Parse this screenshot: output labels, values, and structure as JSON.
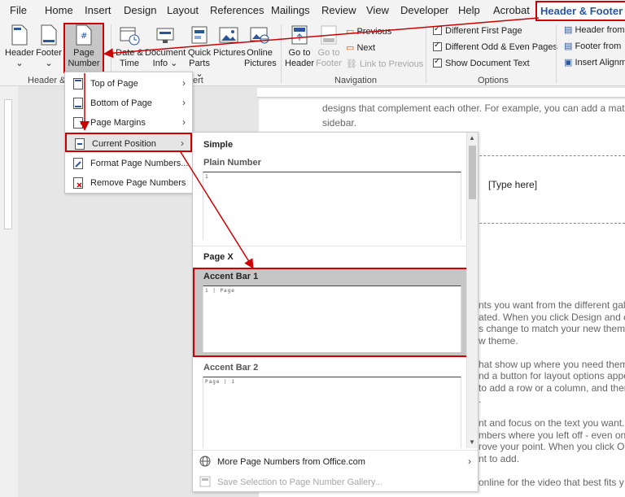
{
  "tabs": [
    {
      "label": "File"
    },
    {
      "label": "Home"
    },
    {
      "label": "Insert"
    },
    {
      "label": "Design"
    },
    {
      "label": "Layout"
    },
    {
      "label": "References"
    },
    {
      "label": "Mailings"
    },
    {
      "label": "Review"
    },
    {
      "label": "View"
    },
    {
      "label": "Developer"
    },
    {
      "label": "Help"
    },
    {
      "label": "Acrobat"
    },
    {
      "label": "Header & Footer"
    }
  ],
  "ribbon": {
    "header": "Header",
    "footer": "Footer",
    "page_number_l1": "Page",
    "page_number_l2": "Number",
    "date_time_l1": "Date &",
    "date_time_l2": "Time",
    "doc_info_l1": "Document",
    "doc_info_l2": "Info",
    "quick_parts_l1": "Quick",
    "quick_parts_l2": "Parts",
    "pictures": "Pictures",
    "online_pictures_l1": "Online",
    "online_pictures_l2": "Pictures",
    "goto_header_l1": "Go to",
    "goto_header_l2": "Header",
    "goto_footer_l1": "Go to",
    "goto_footer_l2": "Footer",
    "previous": "Previous",
    "next": "Next",
    "link_to_previous": "Link to Previous",
    "different_first_page": "Different First Page",
    "different_odd_even": "Different Odd & Even Pages",
    "show_document_text": "Show Document Text",
    "header_from_top": "Header from",
    "footer_from_bottom": "Footer from",
    "insert_alignment": "Insert Alignm",
    "group_header_footer": "Header & F",
    "group_insert": "ert",
    "group_navigation": "Navigation",
    "group_options": "Options"
  },
  "menu": {
    "items": [
      {
        "label": "Top of Page"
      },
      {
        "label": "Bottom of Page"
      },
      {
        "label": "Page Margins"
      },
      {
        "label": "Current Position"
      },
      {
        "label": "Format Page Numbers..."
      },
      {
        "label": "Remove Page Numbers"
      }
    ]
  },
  "gallery": {
    "section_simple": "Simple",
    "plain_number": "Plain Number",
    "plain_number_preview": "1",
    "section_page_x": "Page X",
    "accent_bar_1": "Accent Bar 1",
    "accent_bar_1_preview": "1 | Page",
    "accent_bar_2": "Accent Bar 2",
    "accent_bar_2_preview": "Page | 1",
    "more_from_office": "More Page Numbers from Office.com",
    "save_selection": "Save Selection to Page Number Gallery..."
  },
  "document": {
    "line1": "designs that complement each other. For example, you can add a matching",
    "line2": "sidebar.",
    "type_here": "[Type here]",
    "body_lines": [
      "nts you want from the different gal",
      "ated. When you click Design and ch",
      "s change to match your new theme.",
      "w theme.",
      "",
      "hat show up where you need them.",
      "nd a button for layout options appe",
      " to add a row or a column, and then",
      ".",
      "",
      "nt and focus on the text you want. If",
      "mbers where you left off - even on a",
      "rove your point. When you click Onl",
      "nt to add.",
      "",
      "online for the video that best fits y"
    ]
  },
  "colors": {
    "highlight_red": "#cc0000",
    "accent_blue": "#2b579a"
  }
}
